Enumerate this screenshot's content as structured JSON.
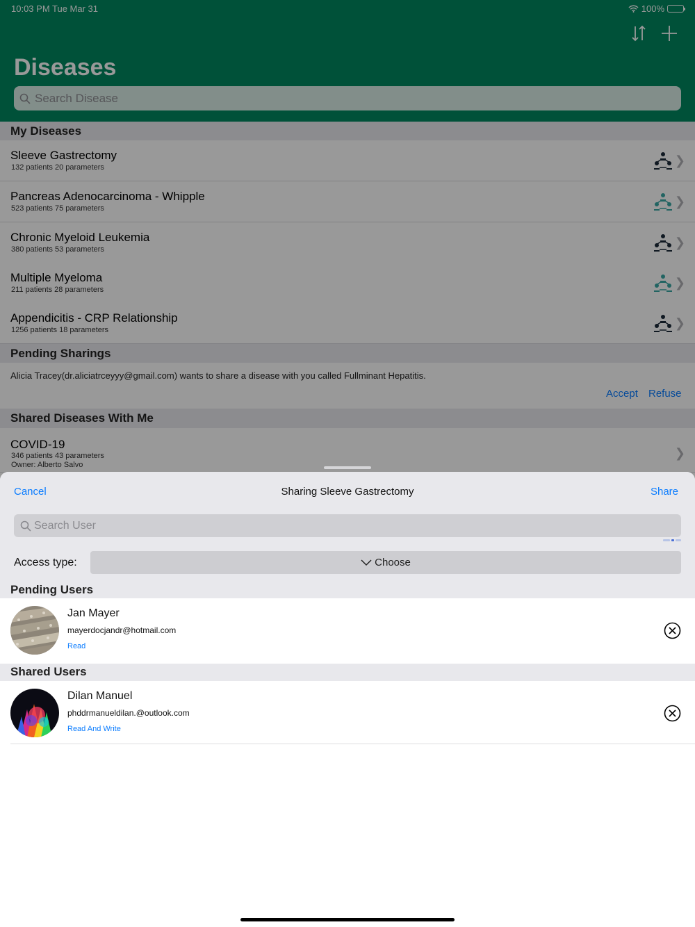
{
  "status_bar": {
    "time": "10:03 PM   Tue Mar 31",
    "battery": "100%"
  },
  "header": {
    "title": "Diseases",
    "search_placeholder": "Search Disease"
  },
  "my_diseases": {
    "heading": "My Diseases",
    "items": [
      {
        "name": "Sleeve Gastrectomy",
        "meta": "132 patients   20 parameters"
      },
      {
        "name": "Pancreas Adenocarcinoma - Whipple",
        "meta": "523 patients   75 parameters"
      },
      {
        "name": "Chronic Myeloid Leukemia",
        "meta": "380 patients   53 parameters"
      },
      {
        "name": "Multiple Myeloma",
        "meta": "211 patients   28 parameters"
      },
      {
        "name": "Appendicitis - CRP Relationship",
        "meta": "1256 patients   18 parameters"
      }
    ]
  },
  "pending_sharings": {
    "heading": "Pending Sharings",
    "message": "Alicia Tracey(dr.aliciatrceyyy@gmail.com) wants to share a disease with you called Fullminant Hepatitis.",
    "accept": "Accept",
    "refuse": "Refuse"
  },
  "shared_with_me": {
    "heading": "Shared Diseases With Me",
    "items": [
      {
        "name": "COVID-19",
        "meta": "346 patients   43 parameters",
        "owner": "Owner: Alberto Salvo"
      }
    ]
  },
  "sheet": {
    "cancel": "Cancel",
    "title": "Sharing Sleeve Gastrectomy",
    "share": "Share",
    "search_placeholder": "Search User",
    "access_label": "Access type:",
    "access_value": "Choose",
    "pending_heading": "Pending Users",
    "shared_heading": "Shared Users",
    "pending_users": [
      {
        "name": "Jan Mayer",
        "email": "mayerdocjandr@hotmail.com",
        "access": "Read"
      }
    ],
    "shared_users": [
      {
        "name": "Dilan Manuel",
        "email": "phddrmanueldilan.@outlook.com",
        "access": "Read And Write"
      }
    ]
  },
  "colors": {
    "nav_green": "#00875f",
    "link_blue": "#0a7cff",
    "section_gray": "#e8e8ec"
  }
}
